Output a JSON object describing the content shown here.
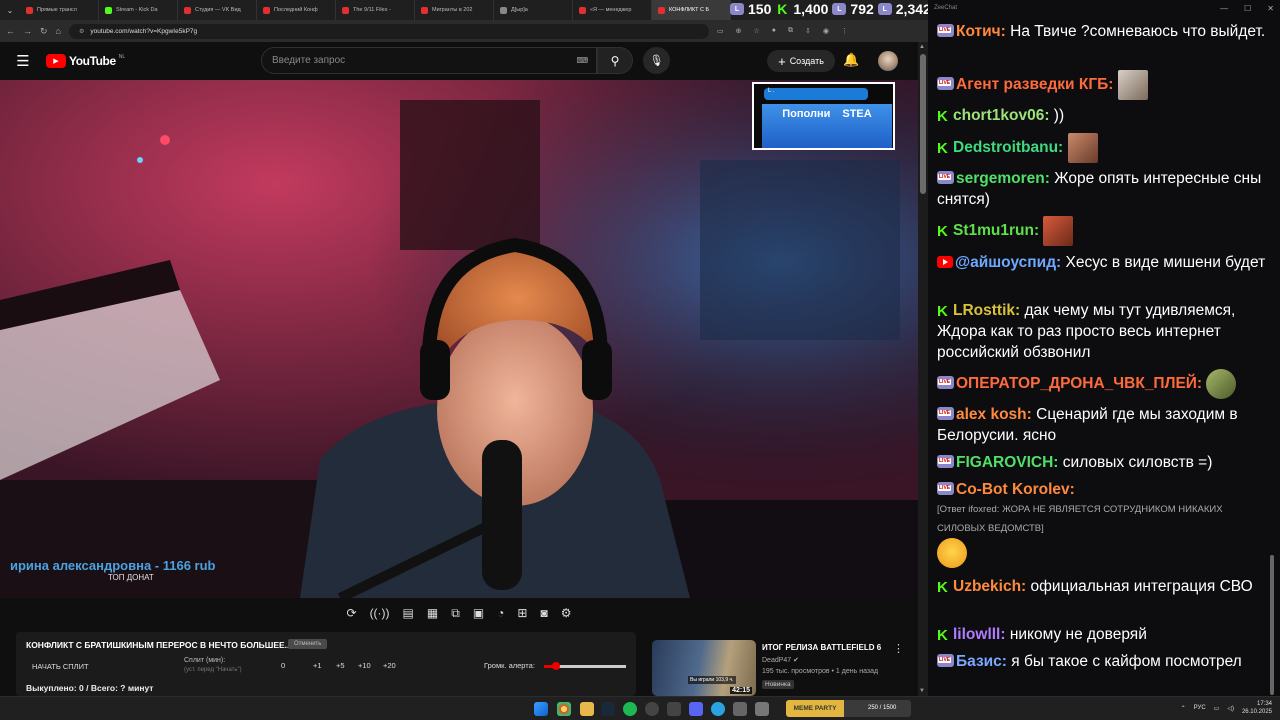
{
  "browser": {
    "tabs": [
      {
        "label": "Прямые трансл",
        "color": "#e03030"
      },
      {
        "label": "Stream - Kick Da",
        "color": "#53fc18"
      },
      {
        "label": "Студия — VK Вид",
        "color": "#e03030"
      },
      {
        "label": "Последний Конф",
        "color": "#e03030"
      },
      {
        "label": "The 9/11 Files -",
        "color": "#e03030"
      },
      {
        "label": "Мигранты в 202",
        "color": "#e03030"
      },
      {
        "label": "Д[ыр]а",
        "color": "#888888"
      },
      {
        "label": "«Я — менеджер",
        "color": "#e03030"
      },
      {
        "label": "КОНФЛИКТ С Б",
        "color": "#e03030"
      }
    ],
    "url": "youtube.com/watch?v=KpgwIe5kP7g"
  },
  "youtube": {
    "logo": "YouTube",
    "region": "NL",
    "search_placeholder": "Введите запрос",
    "create_label": "Создать"
  },
  "stream_stats": [
    {
      "icon": "live-icon",
      "value": "150",
      "color": "#8a88c9"
    },
    {
      "icon": "kick-icon",
      "value": "1,400",
      "color": "#53fc18"
    },
    {
      "icon": "live-icon",
      "value": "792",
      "color": "#8a88c9"
    },
    {
      "icon": "live-icon",
      "value": "2,342",
      "color": "#8a88c9"
    }
  ],
  "video": {
    "donation_text": "ирина александровна - 1166 rub",
    "top_donat_label": "ТОП ДОНАТ",
    "ad_stripe_text": "L .",
    "ad_words": [
      "Пополни",
      "STEA"
    ]
  },
  "split": {
    "title": "КОНФЛИКТ С БРАТИШКИНЫМ ПЕРЕРОС В НЕЧТО БОЛЬШЕЕ...",
    "cancel_label": "Отменить",
    "start_label": "НАЧАТЬ СПЛИТ",
    "split_label": "Сплит (мин):",
    "split_hint": "(уст. перед \"Начать\")",
    "value": "0",
    "steps": [
      "+1",
      "+5",
      "+10",
      "+20"
    ],
    "alert_label": "Громк. алерта:",
    "alert_volume": 0.15,
    "bought": "Выкуплено: 0 / Всего: ? минут"
  },
  "recommended": {
    "title": "ИТОГ РЕЛИЗА BATTLEFIELD 6",
    "channel": "DeadP47",
    "views": "195 тыс. просмотров • 1 день назад",
    "badge": "Новинка",
    "duration": "42:15",
    "played_text": "Вы играли 103,9 ч."
  },
  "chat": {
    "window_title": "ZeeChat",
    "messages": [
      {
        "platform": "live",
        "user": "Котич:",
        "color": "#ff8a3d",
        "text": "На Твиче ?сомневаюсь что выйдет."
      },
      {
        "platform": "live",
        "user": "Агент разведки КГБ:",
        "color": "#ff6a3d",
        "text": ""
      },
      {
        "platform": "kick",
        "user": "chort1kov06:",
        "color": "#9be27a",
        "text": "))"
      },
      {
        "platform": "kick",
        "user": "Dedstroitbanu:",
        "color": "#3fd97f",
        "text": ""
      },
      {
        "platform": "live",
        "user": "sergemoren:",
        "color": "#4fe06a",
        "text": "Жоре опять интересные сны снятся)"
      },
      {
        "platform": "kick",
        "user": "St1mu1run:",
        "color": "#5de04a",
        "text": ""
      },
      {
        "platform": "yt",
        "user": "@айшоуспид:",
        "color": "#6fa8ff",
        "text": "Хесус в виде мишени будет"
      },
      {
        "platform": "kick",
        "user": "LRosttik:",
        "color": "#d8c23a",
        "text": "дак чему мы тут удивляемся, Ждора как то раз просто весь интернет российский обзвонил"
      },
      {
        "platform": "live",
        "user": "ОПЕРАТОР_ДРОНА_ЧВК_ПЛЕЙ:",
        "color": "#ff6a3d",
        "text": ""
      },
      {
        "platform": "live",
        "user": "alex kosh:",
        "color": "#ff8a3d",
        "text": "Сценарий где мы заходим в Белорусии. ясно"
      },
      {
        "platform": "live",
        "user": "FIGAROVICH:",
        "color": "#4fe06a",
        "text": "силовых силовств =)"
      },
      {
        "platform": "live",
        "user": "Co-Bot Korolev:",
        "color": "#ff8a3d",
        "text": ""
      },
      {
        "platform": "kick",
        "user": "Uzbekich:",
        "color": "#ff8a3d",
        "text": "официальная интеграция СВО"
      },
      {
        "platform": "kick",
        "user": "lilowlll:",
        "color": "#b07cff",
        "text": "никому не доверяй"
      },
      {
        "platform": "live",
        "user": "Базис:",
        "color": "#7aa7ff",
        "text": "я бы такое с кайфом посмотрел"
      }
    ],
    "reply": "[Ответ ifoxred: ЖОРА НЕ ЯВЛЯЕТСЯ СОТРУДНИКОМ НИКАКИХ СИЛОВЫХ ВЕДОМСТВ]"
  },
  "taskbar": {
    "lang": "РУС",
    "time": "17:34",
    "date": "26.10.2025",
    "meme_party": "МЕМЕ PARTY",
    "meme_count": "250 / 1500"
  }
}
